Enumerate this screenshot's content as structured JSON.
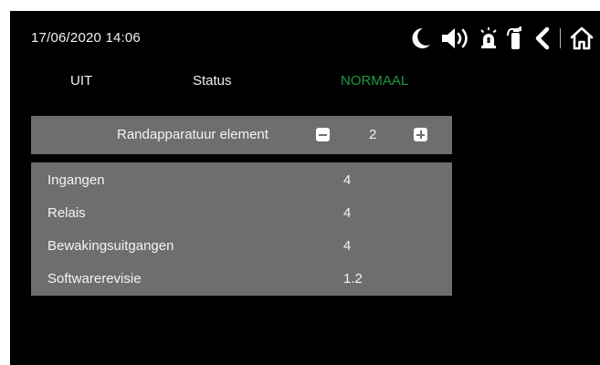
{
  "header": {
    "datetime": "17/06/2020  14:06",
    "icons": [
      "moon-icon",
      "speaker-icon",
      "siren-icon",
      "fire-extinguisher-icon",
      "back-chevron-icon",
      "home-icon"
    ]
  },
  "status_row": {
    "mode": "UIT",
    "label": "Status",
    "value": "NORMAAL",
    "value_color": "#1f9a3e"
  },
  "element_selector": {
    "title": "Randapparatuur element",
    "value": "2"
  },
  "info": {
    "rows": [
      {
        "label": "Ingangen",
        "value": "4"
      },
      {
        "label": "Relais",
        "value": "4"
      },
      {
        "label": "Bewakingsuitgangen",
        "value": "4"
      },
      {
        "label": "Softwarerevisie",
        "value": "1.2"
      }
    ]
  },
  "colors": {
    "background": "#000000",
    "panel": "#6e6e6e",
    "accent_green": "#1f9a3e"
  }
}
